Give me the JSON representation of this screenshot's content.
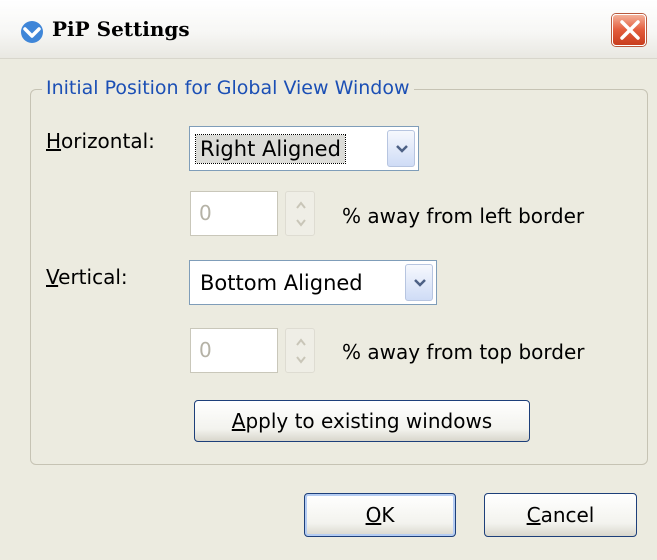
{
  "window": {
    "title": "PiP Settings"
  },
  "group": {
    "title": "Initial Position for Global View Window"
  },
  "horizontal": {
    "label_mnemonic": "H",
    "label_rest": "orizontal:",
    "selected": "Right Aligned",
    "offset_value": "0",
    "offset_suffix": "% away from left border"
  },
  "vertical": {
    "label_mnemonic": "V",
    "label_rest": "ertical:",
    "selected": "Bottom Aligned",
    "offset_value": "0",
    "offset_suffix": "% away from top border"
  },
  "apply_button": {
    "mnemonic": "A",
    "rest": "pply to existing windows"
  },
  "ok_button": {
    "mnemonic": "O",
    "rest": "K"
  },
  "cancel_button": {
    "mnemonic": "C",
    "rest": "ancel"
  },
  "icons": {
    "app_logo": "pip-logo-icon",
    "close": "close-icon",
    "dropdown": "chevron-down-icon",
    "spin": "spin-up-down-icon"
  },
  "colors": {
    "group_title": "#1b4fb5",
    "close_button": "#e35c3c",
    "disabled_text": "#b5b2a6"
  }
}
